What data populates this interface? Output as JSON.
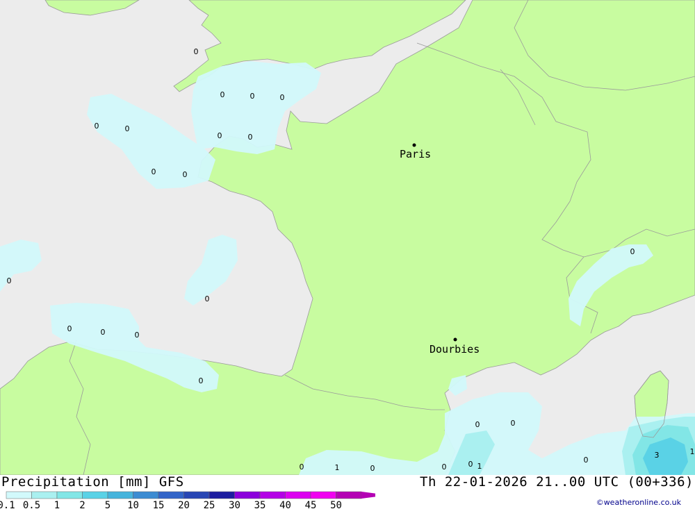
{
  "map": {
    "cities": [
      {
        "name": "Paris"
      },
      {
        "name": "Dourbies"
      }
    ],
    "value_labels": [
      "0",
      "0",
      "0",
      "0",
      "0",
      "0",
      "0",
      "0",
      "0",
      "0",
      "0",
      "0",
      "0",
      "0",
      "0",
      "0",
      "0",
      "0",
      "0",
      "0",
      "0",
      "1",
      "0",
      "0",
      "1",
      "0",
      "3",
      "1"
    ]
  },
  "footer": {
    "title": "Precipitation [mm] GFS",
    "datetime": "Th 22-01-2026 21..00 UTC (00+336)",
    "copyright": "©weatheronline.co.uk"
  },
  "legend": {
    "labels": [
      "0.1",
      "0.5",
      "1",
      "2",
      "5",
      "10",
      "15",
      "20",
      "25",
      "30",
      "35",
      "40",
      "45",
      "50"
    ],
    "colors": [
      "#d2f9fb",
      "#aaf0f0",
      "#82e6e6",
      "#5ad2e6",
      "#46b4dc",
      "#3c8cd2",
      "#3264c8",
      "#2846b4",
      "#1e1ea0",
      "#8c00dc",
      "#b400e6",
      "#dc00f0",
      "#f000f0",
      "#b400b4"
    ]
  }
}
